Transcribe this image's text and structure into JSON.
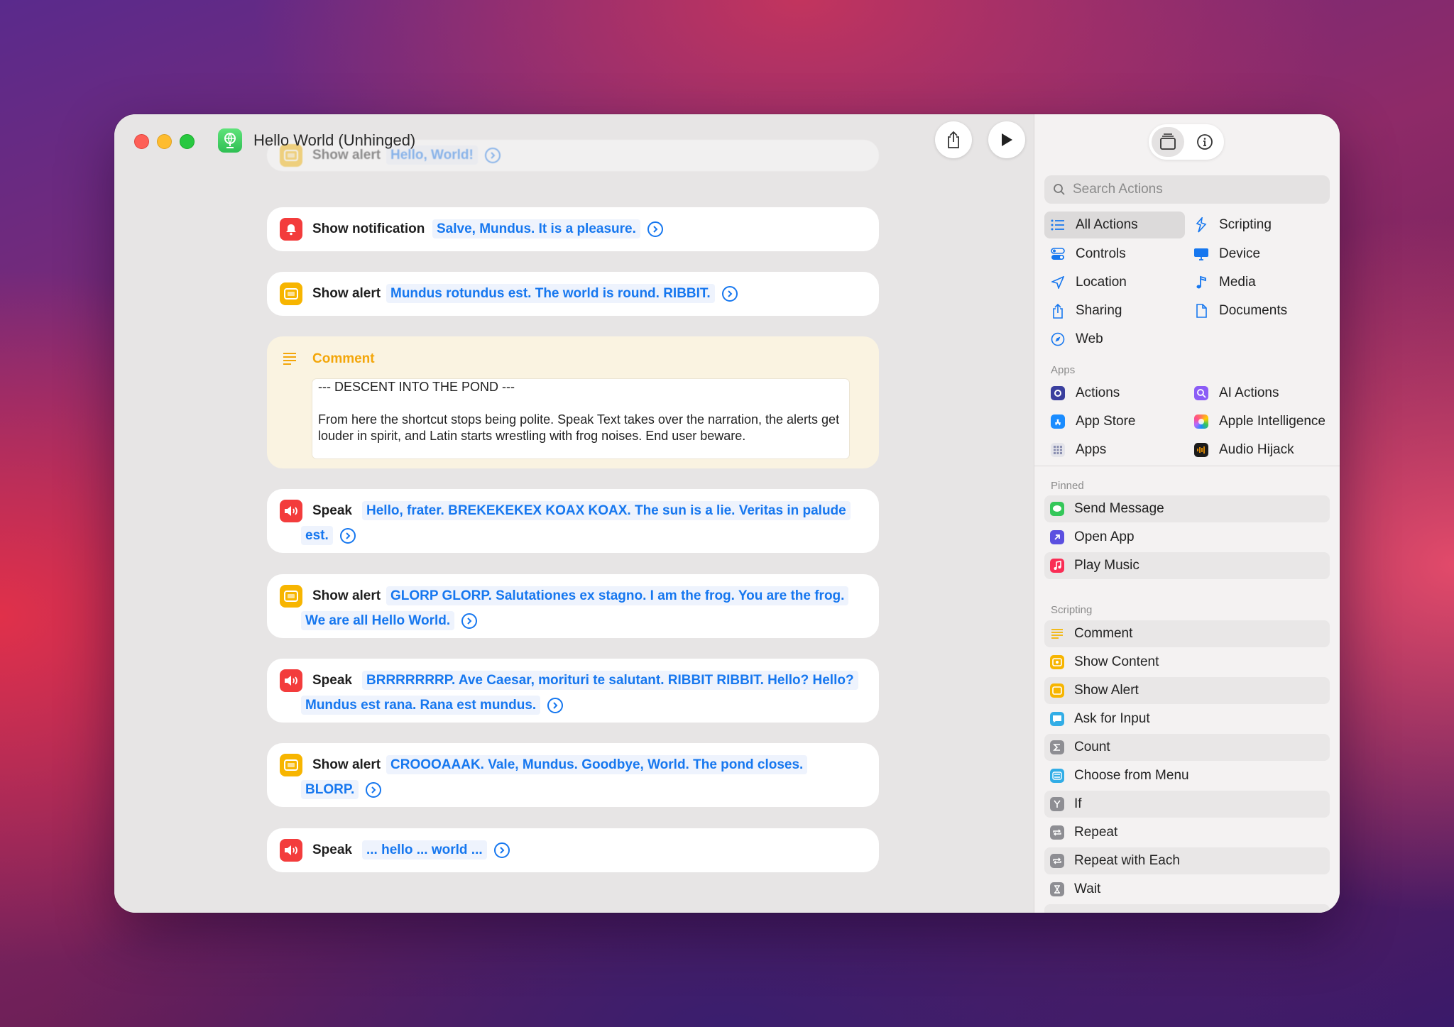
{
  "window": {
    "title": "Hello World (Unhinged)"
  },
  "editor": {
    "actions": [
      {
        "label": "Show alert",
        "text": "Hello, World!"
      },
      {
        "label": "Show notification",
        "text": "Salve, Mundus. It is a pleasure."
      },
      {
        "label": "Show alert",
        "text": "Mundus rotundus est. The world is round. RIBBIT."
      },
      {
        "label": "Speak",
        "text": "Hello, frater. BREKEKEKEX KOAX KOAX. The sun is a lie. Veritas in palude est."
      },
      {
        "label": "Show alert",
        "text": "GLORP GLORP. Salutationes ex stagno. I am the frog. You are the frog. We are all Hello World."
      },
      {
        "label": "Speak",
        "text": "BRRRRRRRP. Ave Caesar, morituri te salutant. RIBBIT RIBBIT. Hello? Hello? Mundus est rana. Rana est mundus."
      },
      {
        "label": "Show alert",
        "text": "CROOOAAAK. Vale, Mundus. Goodbye, World. The pond closes. BLORP."
      },
      {
        "label": "Speak",
        "text": "... hello ... world ..."
      }
    ],
    "comment": {
      "title": "Comment",
      "line1": "--- DESCENT INTO THE POND ---",
      "line2": "From here the shortcut stops being polite. Speak Text takes over the narration, the alerts get louder in spirit, and Latin starts wrestling with frog noises. End user beware."
    }
  },
  "sidebar": {
    "search_placeholder": "Search Actions",
    "categories": [
      {
        "label": "All Actions",
        "icon": "list-icon"
      },
      {
        "label": "Scripting",
        "icon": "scripting-icon"
      },
      {
        "label": "Controls",
        "icon": "toggle-icon"
      },
      {
        "label": "Device",
        "icon": "display-icon"
      },
      {
        "label": "Location",
        "icon": "location-arrow-icon"
      },
      {
        "label": "Media",
        "icon": "music-note-icon"
      },
      {
        "label": "Sharing",
        "icon": "share-icon"
      },
      {
        "label": "Documents",
        "icon": "document-icon"
      },
      {
        "label": "Web",
        "icon": "compass-icon"
      }
    ],
    "apps_header": "Apps",
    "apps": [
      {
        "label": "Actions",
        "icon": "actions-app-icon"
      },
      {
        "label": "AI Actions",
        "icon": "ai-actions-app-icon"
      },
      {
        "label": "App Store",
        "icon": "app-store-icon"
      },
      {
        "label": "Apple Intelligence",
        "icon": "apple-intelligence-icon"
      },
      {
        "label": "Apps",
        "icon": "apps-grid-icon"
      },
      {
        "label": "Audio Hijack",
        "icon": "audio-hijack-icon"
      }
    ],
    "pinned_header": "Pinned",
    "pinned": [
      {
        "label": "Send Message",
        "icon": "messages-icon"
      },
      {
        "label": "Open App",
        "icon": "open-app-icon"
      },
      {
        "label": "Play Music",
        "icon": "music-app-icon"
      }
    ],
    "scripting_header": "Scripting",
    "scripting": [
      {
        "label": "Comment",
        "icon": "comment-icon"
      },
      {
        "label": "Show Content",
        "icon": "show-content-icon"
      },
      {
        "label": "Show Alert",
        "icon": "show-alert-icon"
      },
      {
        "label": "Ask for Input",
        "icon": "ask-input-icon"
      },
      {
        "label": "Count",
        "icon": "sigma-icon"
      },
      {
        "label": "Choose from Menu",
        "icon": "menu-icon"
      },
      {
        "label": "If",
        "icon": "if-icon"
      },
      {
        "label": "Repeat",
        "icon": "repeat-icon"
      },
      {
        "label": "Repeat with Each",
        "icon": "repeat-each-icon"
      },
      {
        "label": "Wait",
        "icon": "hourglass-icon"
      }
    ]
  },
  "colors": {
    "accent": "#1677ef",
    "alert": "#f7b500",
    "speak": "#f33c3c",
    "comment": "#f3a60a"
  }
}
